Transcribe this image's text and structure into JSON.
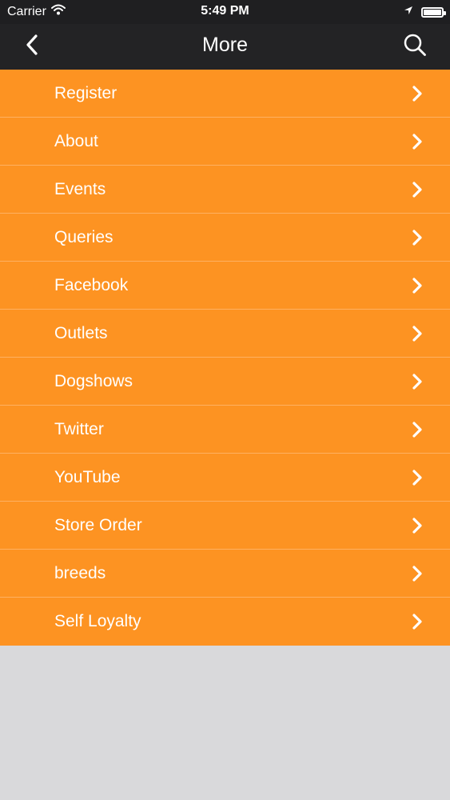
{
  "status_bar": {
    "carrier": "Carrier",
    "time": "5:49 PM"
  },
  "nav": {
    "title": "More",
    "back_icon": "chevron-left-icon",
    "search_icon": "search-icon"
  },
  "menu": {
    "items": [
      {
        "label": "Register"
      },
      {
        "label": "About"
      },
      {
        "label": "Events"
      },
      {
        "label": "Queries"
      },
      {
        "label": "Facebook"
      },
      {
        "label": "Outlets"
      },
      {
        "label": "Dogshows"
      },
      {
        "label": "Twitter"
      },
      {
        "label": "YouTube"
      },
      {
        "label": "Store Order"
      },
      {
        "label": "breeds"
      },
      {
        "label": "Self Loyalty"
      }
    ]
  },
  "colors": {
    "menu_background": "#fd9322",
    "menu_divider": "#ffb061",
    "nav_background": "#232325",
    "page_background": "#d9d9db"
  }
}
